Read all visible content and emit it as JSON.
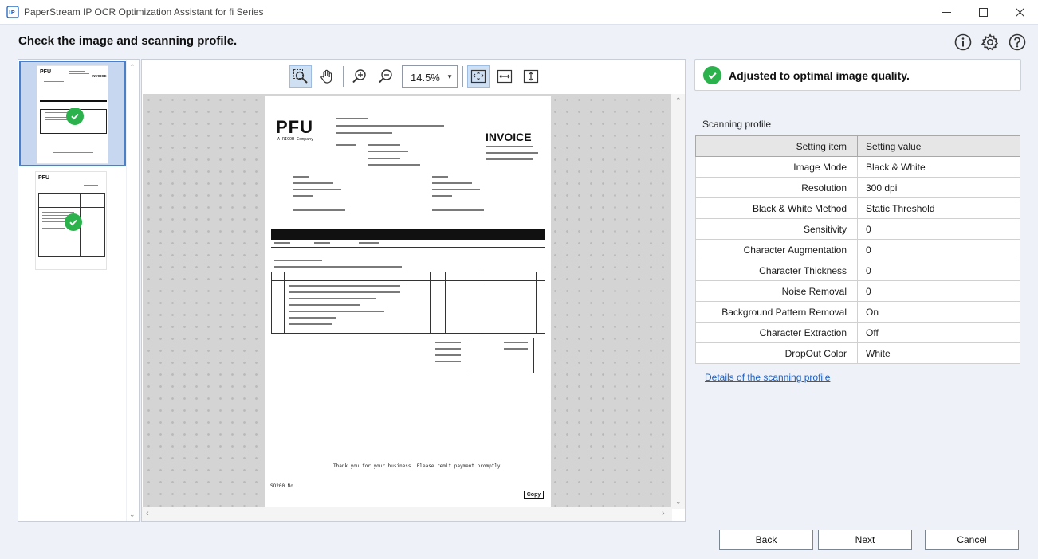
{
  "window": {
    "title": "PaperStream IP OCR Optimization Assistant for fi Series",
    "app_icon_label": "IP"
  },
  "header": {
    "title": "Check the image and scanning profile.",
    "icons": [
      "info-icon",
      "gear-icon",
      "help-icon"
    ]
  },
  "thumbnails": [
    {
      "page": 1,
      "selected": true,
      "status": "check"
    },
    {
      "page": 2,
      "selected": false,
      "status": "check"
    }
  ],
  "viewer": {
    "zoom": "14.5%",
    "tools": [
      "zoom-area-tool",
      "hand-tool",
      "zoom-in",
      "zoom-out",
      "fit-page",
      "fit-width",
      "fit-height"
    ]
  },
  "document": {
    "logo": "PFU",
    "logo_sub": "A RICOH Company",
    "title": "INVOICE",
    "footer_text": "Thank you for your business. Please remit payment promptly.",
    "doc_number": "SO200 No.",
    "copy_label": "Copy"
  },
  "status": {
    "text": "Adjusted to optimal image quality.",
    "color": "#2bb24c"
  },
  "profile": {
    "label": "Scanning profile",
    "columns": {
      "item": "Setting item",
      "value": "Setting value"
    },
    "rows": [
      {
        "item": "Image Mode",
        "value": "Black & White"
      },
      {
        "item": "Resolution",
        "value": "300 dpi"
      },
      {
        "item": "Black & White Method",
        "value": "Static Threshold"
      },
      {
        "item": "Sensitivity",
        "value": "0"
      },
      {
        "item": "Character Augmentation",
        "value": "0"
      },
      {
        "item": "Character Thickness",
        "value": "0"
      },
      {
        "item": "Noise Removal",
        "value": "0"
      },
      {
        "item": "Background Pattern Removal",
        "value": "On"
      },
      {
        "item": "Character Extraction",
        "value": "Off"
      },
      {
        "item": "DropOut Color",
        "value": "White"
      }
    ],
    "details_link": "Details of the scanning profile"
  },
  "buttons": {
    "back": "Back",
    "next": "Next",
    "cancel": "Cancel"
  }
}
